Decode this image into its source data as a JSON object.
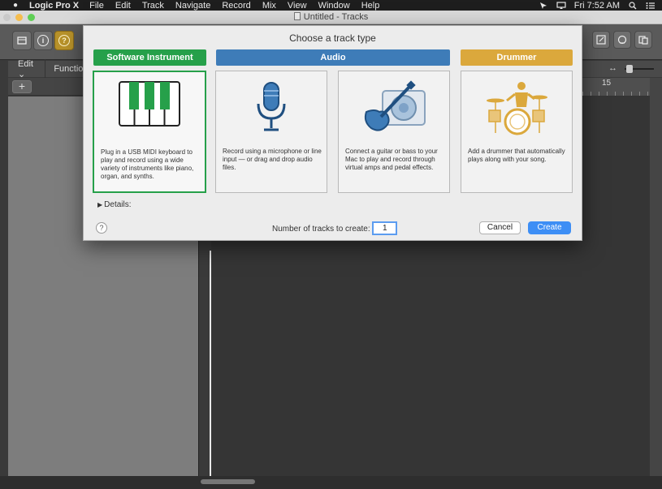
{
  "menubar": {
    "app_name": "Logic Pro X",
    "items": [
      "File",
      "Edit",
      "Track",
      "Navigate",
      "Record",
      "Mix",
      "View",
      "Window",
      "Help"
    ],
    "clock": "Fri 7:52 AM",
    "icons": [
      "apple-icon",
      "cursor-icon",
      "display-icon",
      "search-icon",
      "list-icon"
    ]
  },
  "window": {
    "title": "Untitled - Tracks"
  },
  "editbar": {
    "edit_label": "Edit",
    "functions_label": "Functions"
  },
  "ruler": {
    "bar_label": "15"
  },
  "dialog": {
    "title": "Choose a track type",
    "types": [
      {
        "label": "Software Instrument",
        "color": "#26a04a",
        "description": "Plug in a USB MIDI keyboard to play and record using a wide variety of instruments like piano, organ, and synths.",
        "icon": "piano-keys-icon",
        "selected": true
      },
      {
        "label": "Audio",
        "color": "#3e7cb8",
        "description": "Record using a microphone or line input — or drag and drop audio files.",
        "icon": "microphone-icon",
        "selected": false
      },
      {
        "label": "",
        "color": "#3e7cb8",
        "description": "Connect a guitar or bass to your Mac to play and record through virtual amps and pedal effects.",
        "icon": "guitar-amp-icon",
        "selected": false
      },
      {
        "label": "Drummer",
        "color": "#dba83c",
        "description": "Add a drummer that automatically plays along with your song.",
        "icon": "drummer-icon",
        "selected": false
      }
    ],
    "details_label": "Details:",
    "help_label": "?",
    "count_label": "Number of tracks to create:",
    "count_value": "1",
    "cancel_label": "Cancel",
    "create_label": "Create"
  }
}
